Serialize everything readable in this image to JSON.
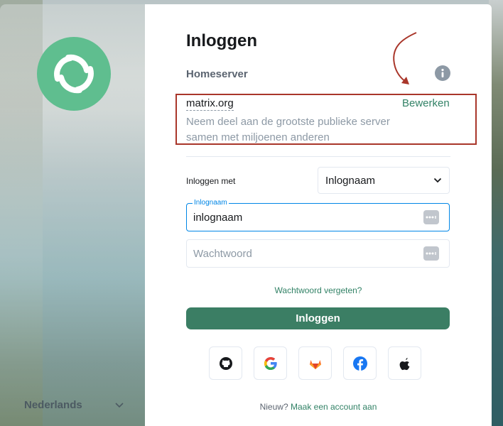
{
  "sidebar": {
    "language": "Nederlands",
    "logo_color": "#5fbe8f"
  },
  "login": {
    "title": "Inloggen",
    "homeserver_label": "Homeserver",
    "homeserver_name": "matrix.org",
    "homeserver_edit": "Bewerken",
    "homeserver_desc": "Neem deel aan de grootste publieke server samen met miljoenen anderen",
    "login_with_label": "Inloggen met",
    "login_with_value": "Inlognaam",
    "username_legend": "Inlognaam",
    "username_value": "inlognaam",
    "password_placeholder": "Wachtwoord",
    "forgot_password": "Wachtwoord vergeten?",
    "submit": "Inloggen",
    "sso_providers": [
      "github-icon",
      "google-icon",
      "gitlab-icon",
      "facebook-icon",
      "apple-icon"
    ],
    "footer_prefix": "Nieuw?",
    "footer_link": "Maak een account aan"
  },
  "colors": {
    "accent": "#328266",
    "button": "#3b7e64",
    "focus": "#0086e6",
    "annotation": "#a9362a"
  }
}
